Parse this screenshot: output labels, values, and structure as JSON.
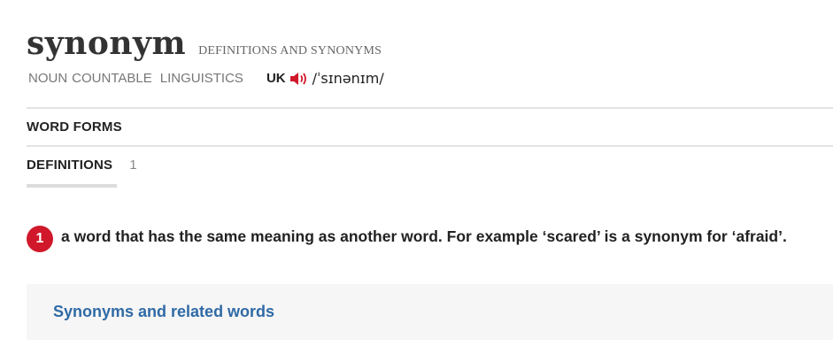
{
  "entry": {
    "headword": "synonym",
    "subtitle": "DEFINITIONS AND SYNONYMS",
    "part_of_speech": "NOUN",
    "grammar": "COUNTABLE",
    "domain": "LINGUISTICS",
    "region": "UK",
    "pronunciation": "/ˈsɪnənɪm/"
  },
  "sections": {
    "word_forms": "WORD FORMS",
    "definitions": "DEFINITIONS",
    "definitions_count": "1"
  },
  "senses": [
    {
      "number": "1",
      "definition": "a word that has the same meaning as another word. For example ‘scared’ is a synonym for ‘afraid’."
    }
  ],
  "related": {
    "label": "Synonyms and related words"
  },
  "colors": {
    "accent_red": "#d0182a",
    "link_blue": "#2f6aa6"
  },
  "icons": {
    "audio": "speaker-icon"
  }
}
